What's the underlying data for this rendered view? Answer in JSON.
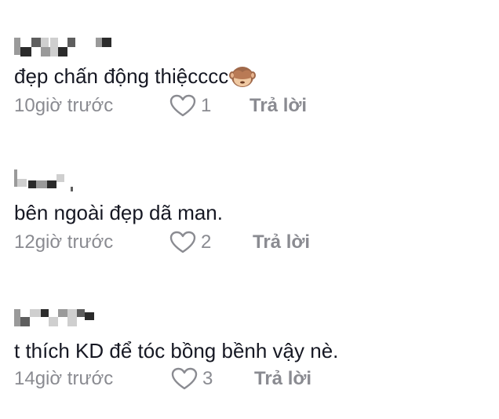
{
  "comments": [
    {
      "text": "đẹp chấn động thiệcccc",
      "emoji": "see-no-evil-monkey-icon",
      "time": "10giờ trước",
      "likes": "1",
      "reply_label": "Trả lời"
    },
    {
      "text": "bên ngoài đẹp dã man.",
      "time": "12giờ trước",
      "likes": "2",
      "reply_label": "Trả lời"
    },
    {
      "text": "t thích KD để tóc bồng bềnh vậy nè.",
      "time": "14giờ trước",
      "likes": "3",
      "reply_label": "Trả lời"
    }
  ],
  "colors": {
    "text": "#161823",
    "secondary": "#8a8b91"
  }
}
